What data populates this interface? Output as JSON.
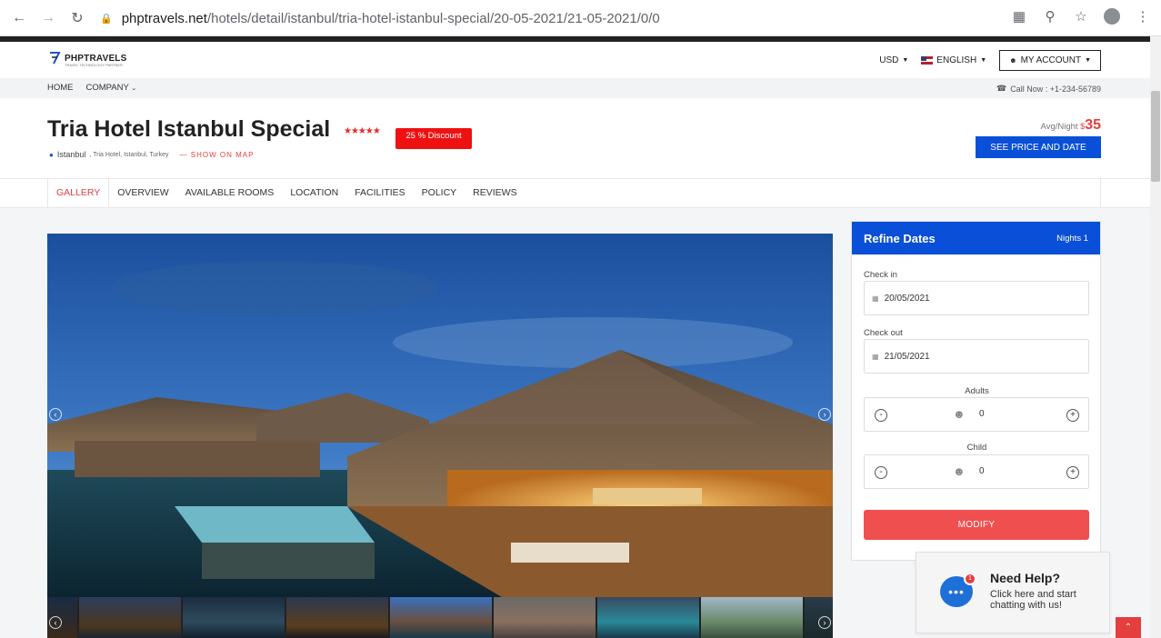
{
  "browser": {
    "url_host": "phptravels.net",
    "url_path": "/hotels/detail/istanbul/tria-hotel-istanbul-special/20-05-2021/21-05-2021/0/0"
  },
  "header": {
    "logo_text": "PHPTRAVELS",
    "logo_sub": "TRAVEL TECHNOLOGY PARTNER",
    "currency": "USD",
    "language": "ENGLISH",
    "account": "MY ACCOUNT"
  },
  "topnav": {
    "home": "HOME",
    "company": "COMPANY",
    "call": "Call Now : +1-234-56789"
  },
  "hotel": {
    "title": "Tria Hotel Istanbul Special",
    "stars": "★★★★★",
    "discount": "25 % Discount",
    "city": "Istanbul",
    "address": ", Tria Hotel, Istanbul, Turkey",
    "show_map": "SHOW ON MAP",
    "avg_label": "Avg/Night",
    "currency_symbol": "$",
    "price": "35",
    "see_price": "SEE PRICE AND DATE"
  },
  "tabs": [
    "GALLERY",
    "OVERVIEW",
    "AVAILABLE ROOMS",
    "LOCATION",
    "FACILITIES",
    "POLICY",
    "REVIEWS"
  ],
  "refine": {
    "title": "Refine Dates",
    "nights": "Nights 1",
    "checkin_label": "Check in",
    "checkin_value": "20/05/2021",
    "checkout_label": "Check out",
    "checkout_value": "21/05/2021",
    "adults_label": "Adults",
    "adults_value": "0",
    "child_label": "Child",
    "child_value": "0",
    "modify": "MODIFY"
  },
  "chat": {
    "badge": "1",
    "title": "Need Help?",
    "subtitle": "Click here and start chatting with us!"
  }
}
